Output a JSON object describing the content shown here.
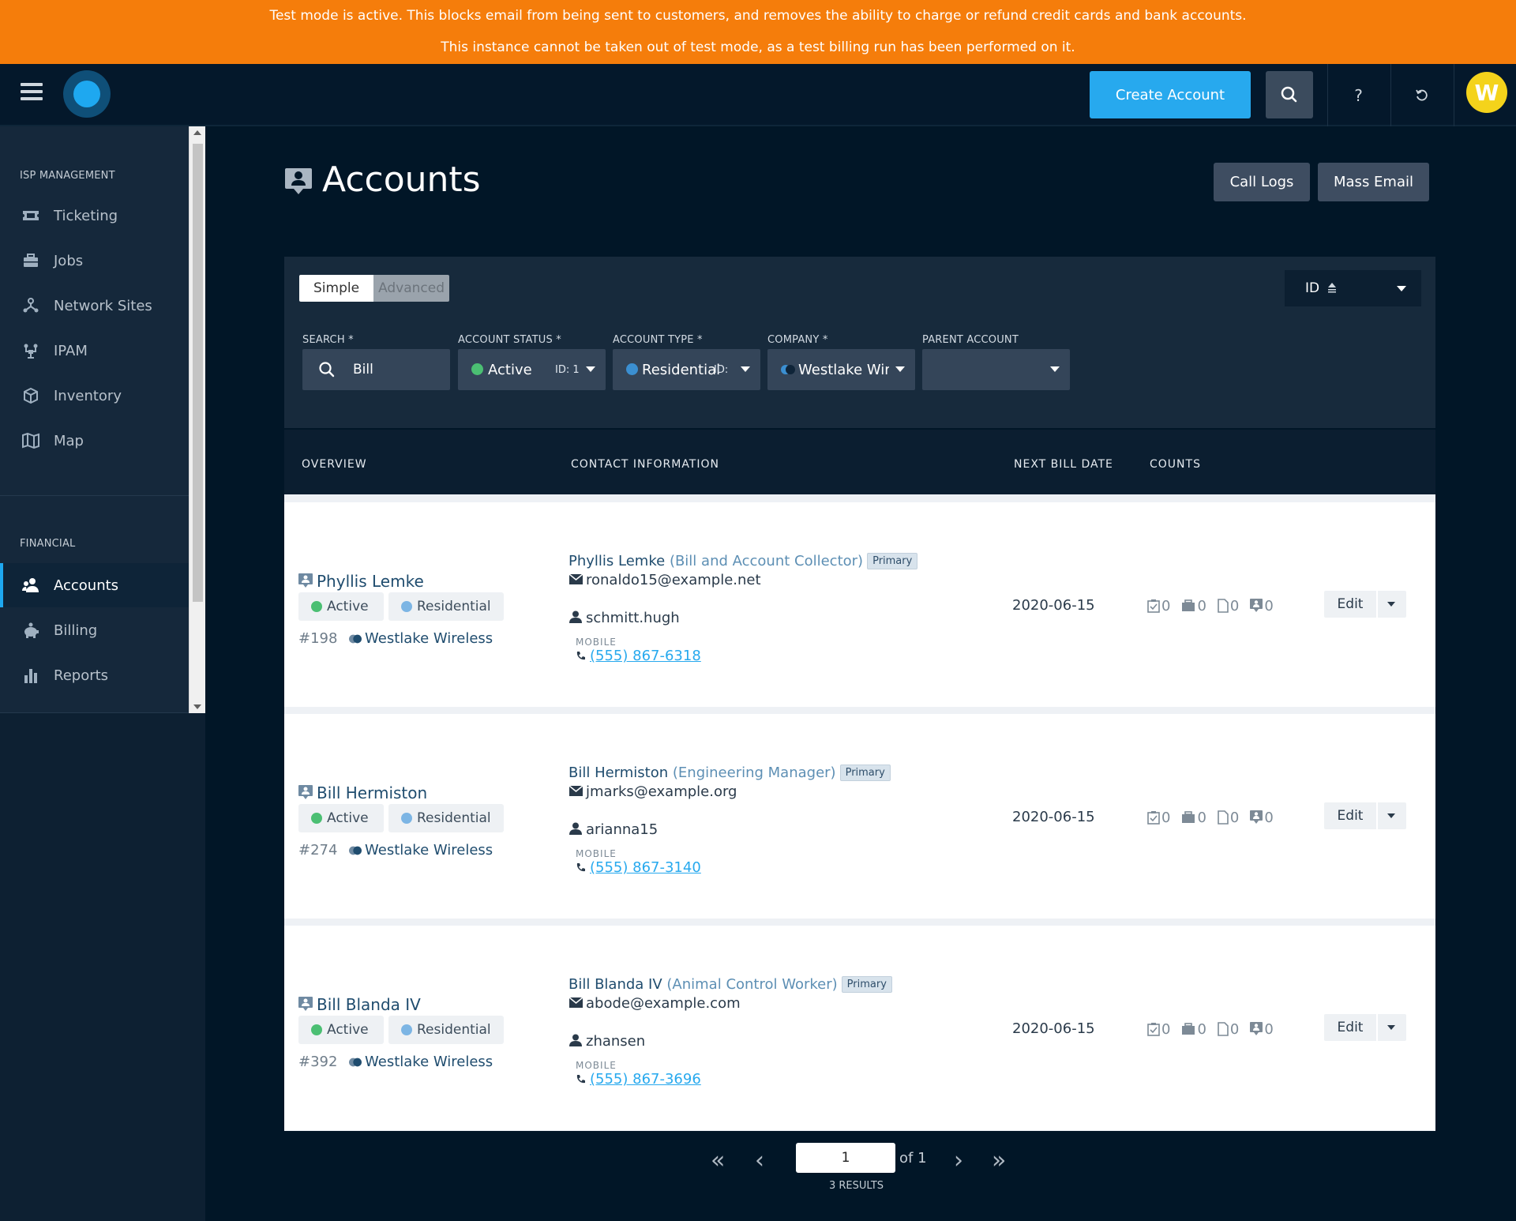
{
  "banner": {
    "line1": "Test mode is active. This blocks email from being sent to customers, and removes the ability to charge or refund credit cards and bank accounts.",
    "line2": "This instance cannot be taken out of test mode, as a test billing run has been performed on it."
  },
  "header": {
    "create_label": "Create Account",
    "help_label": "?",
    "avatar_letter": "W"
  },
  "sidebar": {
    "section_isp": "ISP MANAGEMENT",
    "section_financial": "FINANCIAL",
    "isp_items": [
      {
        "label": "Ticketing",
        "icon": "ticket-icon"
      },
      {
        "label": "Jobs",
        "icon": "briefcase-icon"
      },
      {
        "label": "Network Sites",
        "icon": "network-icon"
      },
      {
        "label": "IPAM",
        "icon": "ipam-icon"
      },
      {
        "label": "Inventory",
        "icon": "box-icon"
      },
      {
        "label": "Map",
        "icon": "map-icon"
      }
    ],
    "financial_items": [
      {
        "label": "Accounts",
        "icon": "users-icon",
        "active": true
      },
      {
        "label": "Billing",
        "icon": "piggy-bank-icon"
      },
      {
        "label": "Reports",
        "icon": "bar-chart-icon"
      }
    ]
  },
  "page": {
    "title": "Accounts",
    "call_logs_label": "Call Logs",
    "mass_email_label": "Mass Email"
  },
  "filters": {
    "mode_simple": "Simple",
    "mode_advanced": "Advanced",
    "sort_label": "ID",
    "search_label": "SEARCH *",
    "search_value": "Bill",
    "status_label": "ACCOUNT STATUS *",
    "status_value": "Active",
    "status_id": "ID: 1",
    "type_label": "ACCOUNT TYPE *",
    "type_value": "Residential",
    "type_id": "ID:",
    "company_label": "COMPANY *",
    "company_value": "Westlake Wireless",
    "parent_label": "PARENT ACCOUNT",
    "colors": {
      "active": "#4bbf73",
      "residential": "#3b8fd1"
    }
  },
  "table": {
    "columns": [
      "OVERVIEW",
      "CONTACT INFORMATION",
      "NEXT BILL DATE",
      "COUNTS"
    ],
    "rows": [
      {
        "name": "Phyllis Lemke",
        "status": "Active",
        "type": "Residential",
        "id": "#198",
        "company": "Westlake Wireless",
        "contact_name": "Phyllis Lemke",
        "contact_role": "(Bill and Account Collector)",
        "primary": "Primary",
        "email": "ronaldo15@example.net",
        "username": "schmitt.hugh",
        "mobile_label": "MOBILE",
        "phone": "(555) 867-6318",
        "next_bill_date": "2020-06-15",
        "counts": [
          "0",
          "0",
          "0",
          "0"
        ],
        "edit_label": "Edit"
      },
      {
        "name": "Bill Hermiston",
        "status": "Active",
        "type": "Residential",
        "id": "#274",
        "company": "Westlake Wireless",
        "contact_name": "Bill Hermiston",
        "contact_role": "(Engineering Manager)",
        "primary": "Primary",
        "email": "jmarks@example.org",
        "username": "arianna15",
        "mobile_label": "MOBILE",
        "phone": "(555) 867-3140",
        "next_bill_date": "2020-06-15",
        "counts": [
          "0",
          "0",
          "0",
          "0"
        ],
        "edit_label": "Edit"
      },
      {
        "name": "Bill Blanda IV",
        "status": "Active",
        "type": "Residential",
        "id": "#392",
        "company": "Westlake Wireless",
        "contact_name": "Bill Blanda IV",
        "contact_role": "(Animal Control Worker)",
        "primary": "Primary",
        "email": "abode@example.com",
        "username": "zhansen",
        "mobile_label": "MOBILE",
        "phone": "(555) 867-3696",
        "next_bill_date": "2020-06-15",
        "counts": [
          "0",
          "0",
          "0",
          "0"
        ],
        "edit_label": "Edit"
      }
    ]
  },
  "pagination": {
    "page": "1",
    "of_label": "of 1",
    "results": "3 RESULTS"
  }
}
